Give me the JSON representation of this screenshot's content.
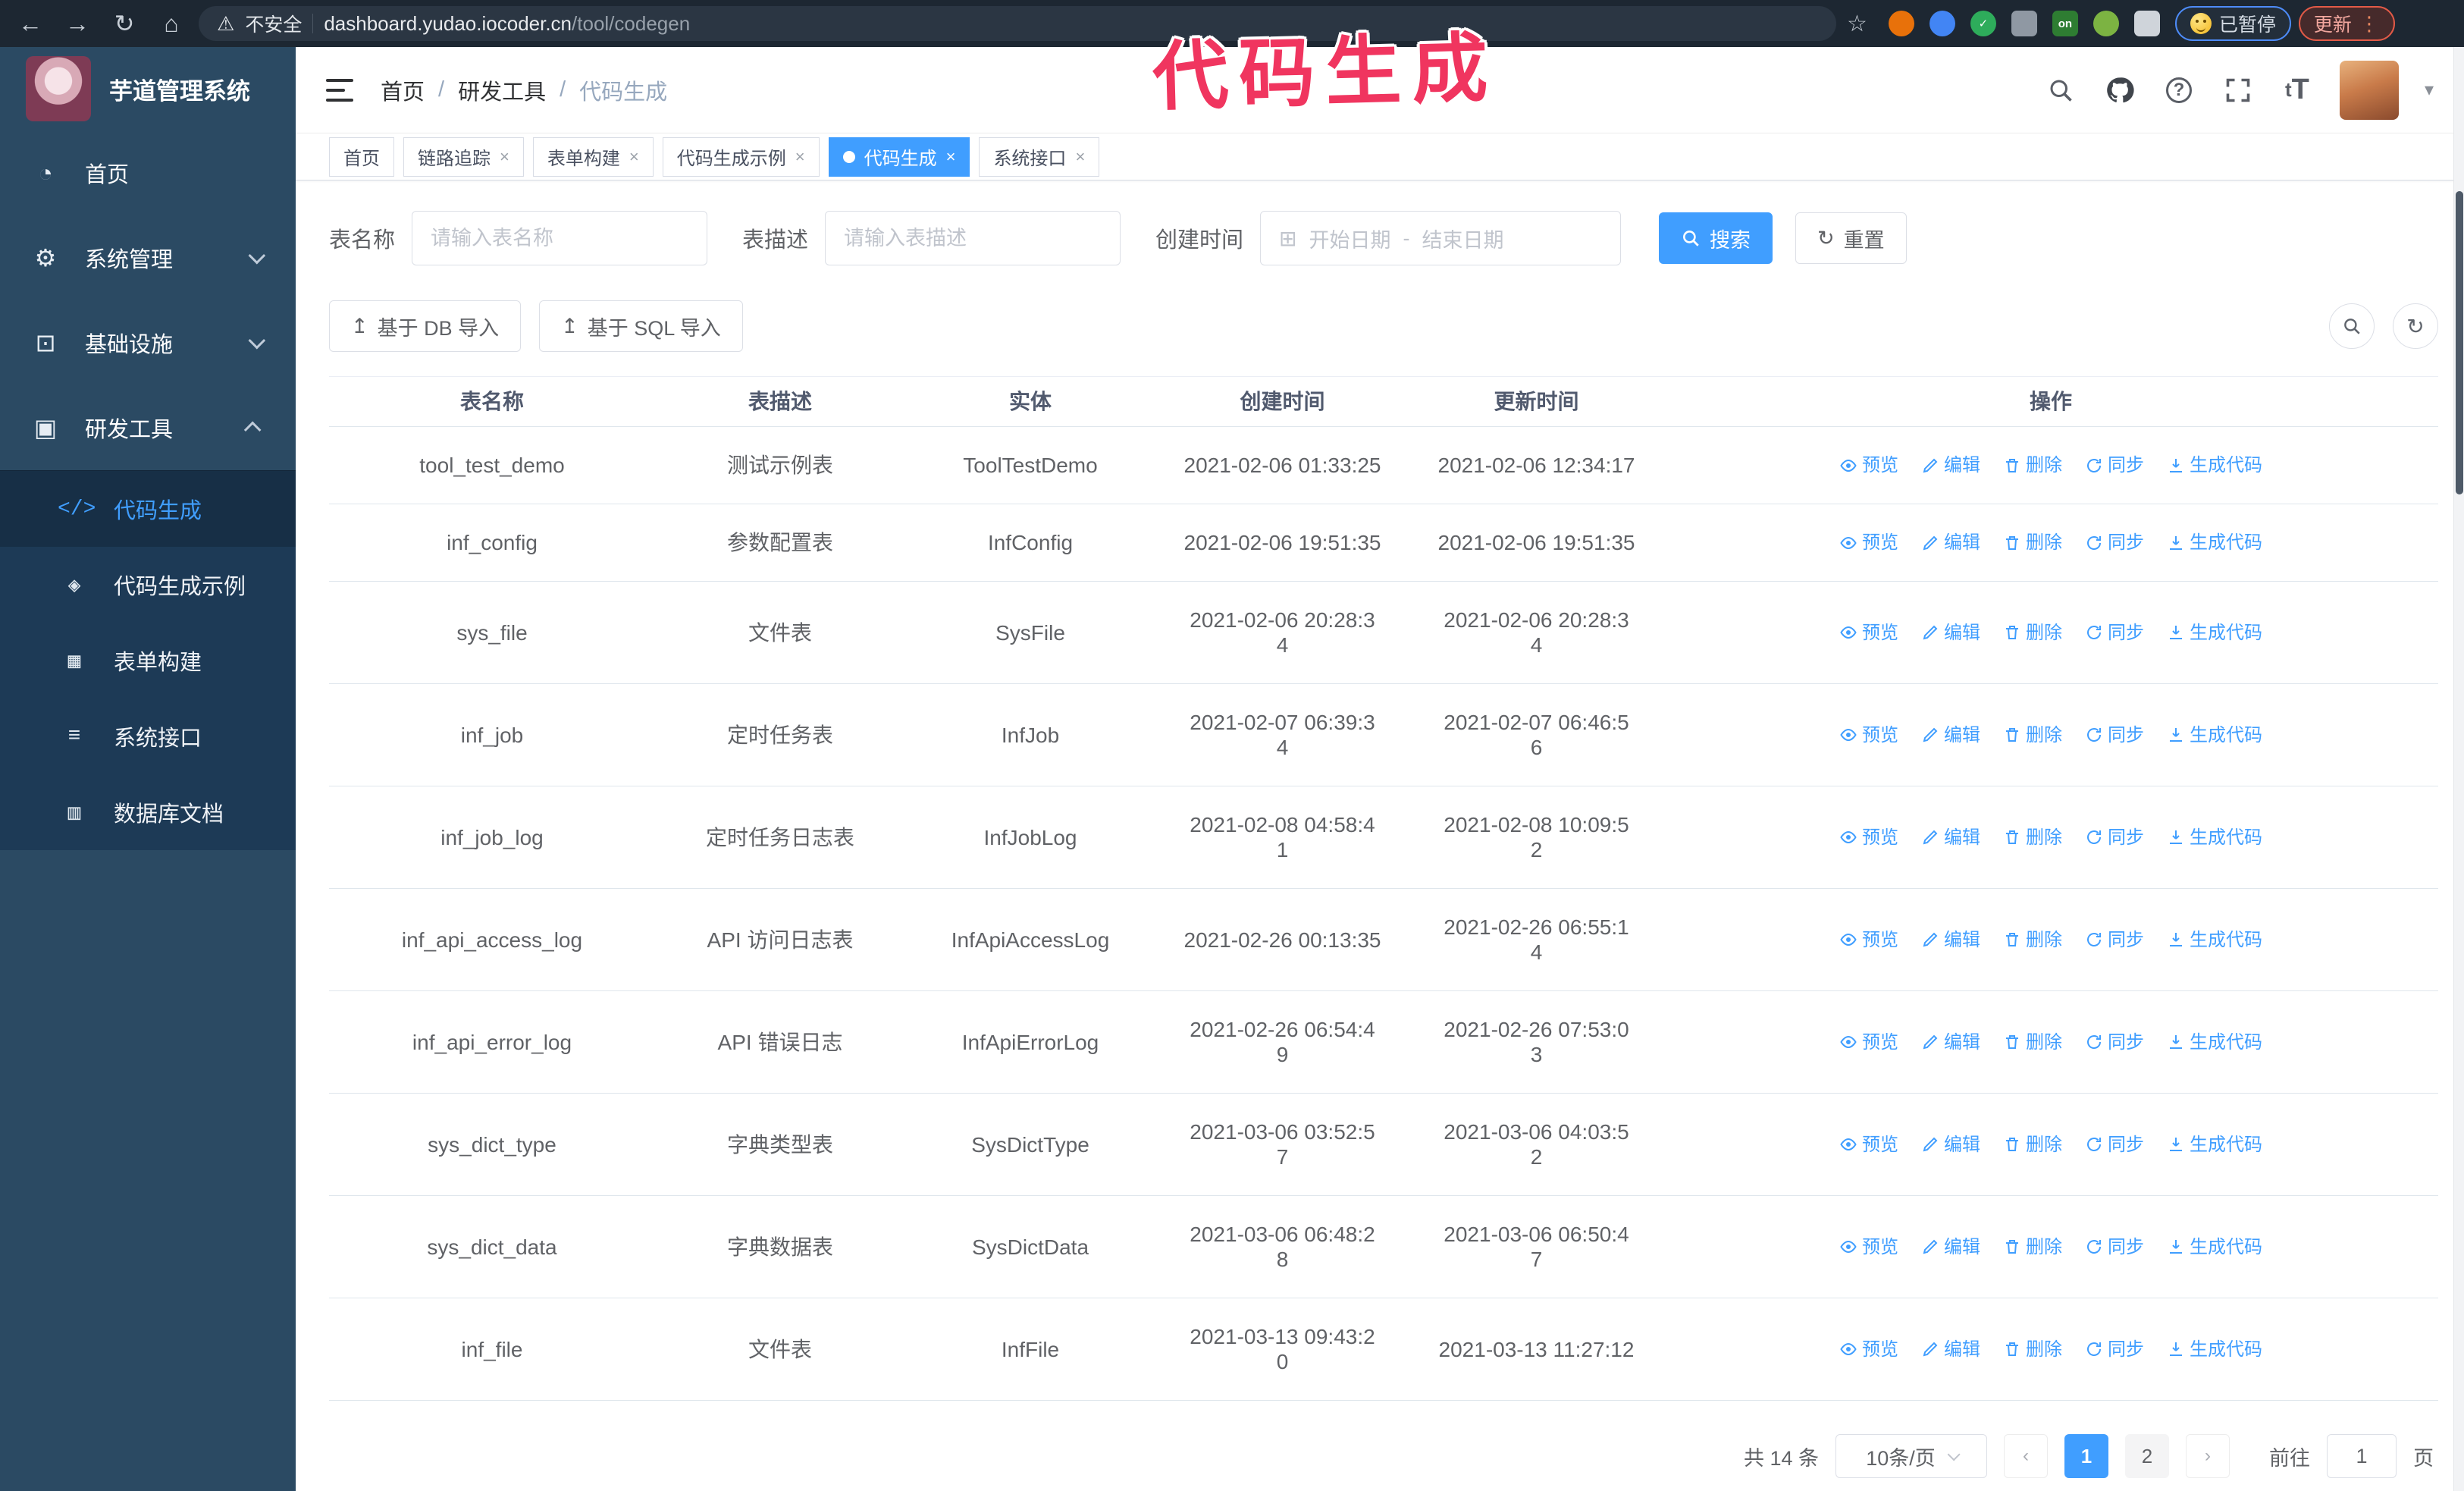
{
  "browser": {
    "security_label": "不安全",
    "url_domain": "dashboard.yudao.iocoder.cn",
    "url_path": "/tool/codegen",
    "paused_badge": "已暂停",
    "update_badge": "更新",
    "update_menu_glyph": "⋮",
    "extensions": [
      {
        "name": "ext-orange-circle",
        "bg": "#e8710a",
        "shape": "circle",
        "label": ""
      },
      {
        "name": "ext-blue-drop",
        "bg": "#4285f4",
        "shape": "circle",
        "label": ""
      },
      {
        "name": "ext-green-check",
        "bg": "#2eac5b",
        "shape": "circle",
        "label": "✓"
      },
      {
        "name": "ext-gray-grid",
        "bg": "#8f98a3",
        "shape": "square",
        "label": ""
      },
      {
        "name": "ext-on-badge",
        "bg": "#2e7d32",
        "shape": "square",
        "label": "on"
      },
      {
        "name": "ext-green-figure",
        "bg": "#7cb342",
        "shape": "circle",
        "label": ""
      },
      {
        "name": "ext-puzzle",
        "bg": "#cfd4da",
        "shape": "square",
        "label": ""
      }
    ]
  },
  "annotation": {
    "text": "代码生成"
  },
  "logo": {
    "title": "芋道管理系统"
  },
  "breadcrumb": {
    "items": [
      "首页",
      "研发工具",
      "代码生成"
    ],
    "separator": "/"
  },
  "sidebar": {
    "items": [
      {
        "label": "首页",
        "icon": "dashboard-icon",
        "glyph": "◔",
        "chevron": ""
      },
      {
        "label": "系统管理",
        "icon": "gear-icon",
        "glyph": "⚙",
        "chevron": "down"
      },
      {
        "label": "基础设施",
        "icon": "monitor-icon",
        "glyph": "⊡",
        "chevron": "down"
      },
      {
        "label": "研发工具",
        "icon": "toolbox-icon",
        "glyph": "▣",
        "chevron": "up"
      }
    ],
    "submenu": [
      {
        "label": "代码生成",
        "icon": "code-icon",
        "glyph": "</>",
        "active": true
      },
      {
        "label": "代码生成示例",
        "icon": "example-icon",
        "glyph": "◈",
        "active": false
      },
      {
        "label": "表单构建",
        "icon": "form-icon",
        "glyph": "▦",
        "active": false
      },
      {
        "label": "系统接口",
        "icon": "api-icon",
        "glyph": "≡",
        "active": false
      },
      {
        "label": "数据库文档",
        "icon": "database-icon",
        "glyph": "▥",
        "active": false
      }
    ]
  },
  "tabs": [
    {
      "label": "首页",
      "closable": false,
      "active": false
    },
    {
      "label": "链路追踪",
      "closable": true,
      "active": false
    },
    {
      "label": "表单构建",
      "closable": true,
      "active": false
    },
    {
      "label": "代码生成示例",
      "closable": true,
      "active": false
    },
    {
      "label": "代码生成",
      "closable": true,
      "active": true
    },
    {
      "label": "系统接口",
      "closable": true,
      "active": false
    }
  ],
  "filters": {
    "name_label": "表名称",
    "name_placeholder": "请输入表名称",
    "desc_label": "表描述",
    "desc_placeholder": "请输入表描述",
    "time_label": "创建时间",
    "start_placeholder": "开始日期",
    "range_separator": "-",
    "end_placeholder": "结束日期",
    "search_label": "搜索",
    "reset_label": "重置"
  },
  "toolbar": {
    "import_db_label": "基于 DB 导入",
    "import_sql_label": "基于 SQL 导入",
    "upload_glyph": "↥"
  },
  "table": {
    "headers": [
      "表名称",
      "表描述",
      "实体",
      "创建时间",
      "更新时间",
      "操作"
    ],
    "actions": [
      "预览",
      "编辑",
      "删除",
      "同步",
      "生成代码"
    ],
    "rows": [
      {
        "name": "tool_test_demo",
        "desc": "测试示例表",
        "entity": "ToolTestDemo",
        "created": [
          "2021-02-06 01:33:25"
        ],
        "updated": [
          "2021-02-06 12:34:17"
        ]
      },
      {
        "name": "inf_config",
        "desc": "参数配置表",
        "entity": "InfConfig",
        "created": [
          "2021-02-06 19:51:35"
        ],
        "updated": [
          "2021-02-06 19:51:35"
        ]
      },
      {
        "name": "sys_file",
        "desc": "文件表",
        "entity": "SysFile",
        "created": [
          "2021-02-06 20:28:3",
          "4"
        ],
        "updated": [
          "2021-02-06 20:28:3",
          "4"
        ]
      },
      {
        "name": "inf_job",
        "desc": "定时任务表",
        "entity": "InfJob",
        "created": [
          "2021-02-07 06:39:3",
          "4"
        ],
        "updated": [
          "2021-02-07 06:46:5",
          "6"
        ]
      },
      {
        "name": "inf_job_log",
        "desc": "定时任务日志表",
        "entity": "InfJobLog",
        "created": [
          "2021-02-08 04:58:4",
          "1"
        ],
        "updated": [
          "2021-02-08 10:09:5",
          "2"
        ]
      },
      {
        "name": "inf_api_access_log",
        "desc": "API 访问日志表",
        "entity": "InfApiAccessLog",
        "created": [
          "2021-02-26 00:13:35"
        ],
        "updated": [
          "2021-02-26 06:55:1",
          "4"
        ]
      },
      {
        "name": "inf_api_error_log",
        "desc": "API 错误日志",
        "entity": "InfApiErrorLog",
        "created": [
          "2021-02-26 06:54:4",
          "9"
        ],
        "updated": [
          "2021-02-26 07:53:0",
          "3"
        ]
      },
      {
        "name": "sys_dict_type",
        "desc": "字典类型表",
        "entity": "SysDictType",
        "created": [
          "2021-03-06 03:52:5",
          "7"
        ],
        "updated": [
          "2021-03-06 04:03:5",
          "2"
        ]
      },
      {
        "name": "sys_dict_data",
        "desc": "字典数据表",
        "entity": "SysDictData",
        "created": [
          "2021-03-06 06:48:2",
          "8"
        ],
        "updated": [
          "2021-03-06 06:50:4",
          "7"
        ]
      },
      {
        "name": "inf_file",
        "desc": "文件表",
        "entity": "InfFile",
        "created": [
          "2021-03-13 09:43:2",
          "0"
        ],
        "updated": [
          "2021-03-13 11:27:12"
        ]
      }
    ]
  },
  "pagination": {
    "total_label": "共 14 条",
    "size_label": "10条/页",
    "pages": [
      "1",
      "2"
    ],
    "active_page": "1",
    "prev_glyph": "‹",
    "next_glyph": "›",
    "goto_label": "前往",
    "goto_value": "1",
    "page_label": "页"
  },
  "colors": {
    "accent": "#409eff",
    "sidebar_bg": "#2b4a63",
    "submenu_bg": "#1d3a56",
    "annotation": "#f0355f",
    "browser_bar": "#1d2732"
  }
}
